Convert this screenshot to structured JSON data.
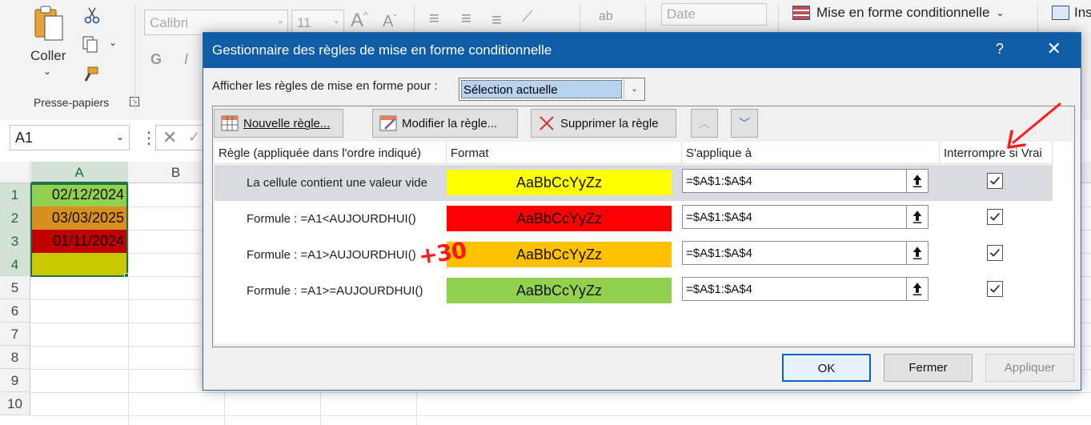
{
  "ribbon": {
    "paste_label": "Coller",
    "clipboard_group": "Presse-papiers",
    "font_name": "Calibri",
    "font_size": "11",
    "bold": "G",
    "italic": "I",
    "grow_font": "A",
    "shrink_font": "A",
    "number_format": "Date",
    "conditional_formatting": "Mise en forme conditionnelle",
    "insert_partial": "Ins"
  },
  "formula_bar": {
    "name_box": "A1"
  },
  "sheet": {
    "columns": [
      "A",
      "B"
    ],
    "rows": [
      "1",
      "2",
      "3",
      "4",
      "5",
      "6",
      "7",
      "8",
      "9",
      "10"
    ],
    "cells": [
      {
        "value": "02/12/2024",
        "fill": "#92d050"
      },
      {
        "value": "03/03/2025",
        "fill": "#d98f1f"
      },
      {
        "value": "01/11/2024",
        "fill": "#c00000"
      },
      {
        "value": "",
        "fill": "#c8c800"
      }
    ]
  },
  "dialog": {
    "title": "Gestionnaire des règles de mise en forme conditionnelle",
    "help": "?",
    "show_rules_label": "Afficher les règles de mise en forme pour :",
    "show_rules_value": "Sélection actuelle",
    "toolbar": {
      "new_rule": "Nouvelle règle...",
      "edit_rule": "Modifier la règle...",
      "delete_rule": "Supprimer la règle"
    },
    "columns": {
      "rule": "Règle (appliquée dans l'ordre indiqué)",
      "format": "Format",
      "applies_to": "S'applique à",
      "stop_if_true": "Interrompre si Vrai"
    },
    "rules": [
      {
        "name": "La cellule contient une valeur vide",
        "preview": "AaBbCcYyZz",
        "color": "#ffff00",
        "applies_to": "=$A$1:$A$4",
        "stop_if_true": true
      },
      {
        "name": "Formule : =A1<AUJOURDHUI()",
        "preview": "AaBbCcYyZz",
        "color": "#ff0000",
        "applies_to": "=$A$1:$A$4",
        "stop_if_true": true
      },
      {
        "name": "Formule : =A1>AUJOURDHUI()",
        "preview": "AaBbCcYyZz",
        "color": "#ffc000",
        "applies_to": "=$A$1:$A$4",
        "stop_if_true": true
      },
      {
        "name": "Formule : =A1>=AUJOURDHUI()",
        "preview": "AaBbCcYyZz",
        "color": "#92d050",
        "applies_to": "=$A$1:$A$4",
        "stop_if_true": true
      }
    ],
    "buttons": {
      "ok": "OK",
      "close": "Fermer",
      "apply": "Appliquer"
    }
  },
  "annotation": {
    "handwritten": "+30",
    "color": "#ff0000"
  }
}
